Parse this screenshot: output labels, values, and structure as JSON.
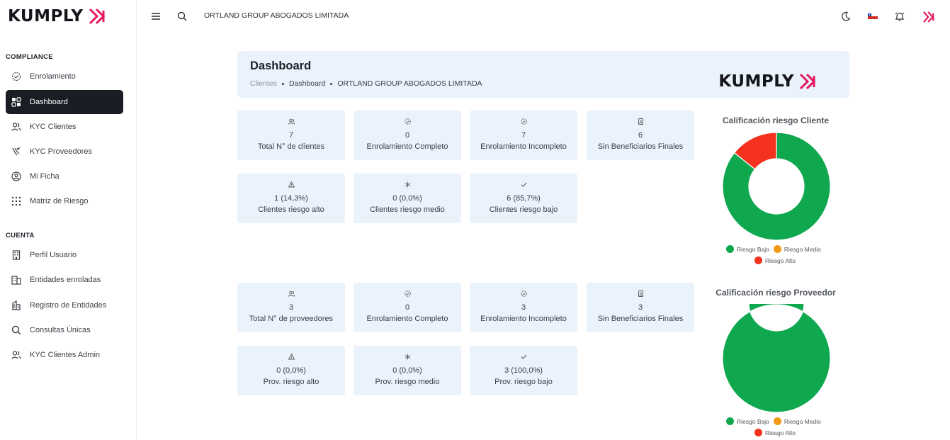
{
  "brand": {
    "logo_text": "KUMPLY",
    "accent": "#e5185f"
  },
  "sidebar": {
    "sections": [
      {
        "label": "COMPLIANCE"
      },
      {
        "label": "CUENTA"
      }
    ],
    "items": [
      {
        "label": "Enrolamiento",
        "icon": "check-circle-icon"
      },
      {
        "label": "Dashboard",
        "icon": "dashboard-grid-icon"
      },
      {
        "label": "KYC Clientes",
        "icon": "users-icon"
      },
      {
        "label": "KYC Proveedores",
        "icon": "handshake-icon"
      },
      {
        "label": "Mi Ficha",
        "icon": "user-circle-icon"
      },
      {
        "label": "Matriz de Riesgo",
        "icon": "dots-grid-icon"
      },
      {
        "label": "Perfil Usuario",
        "icon": "building-icon"
      },
      {
        "label": "Entidades enroladas",
        "icon": "buildings-icon"
      },
      {
        "label": "Registro de Entidades",
        "icon": "building-add-icon"
      },
      {
        "label": "Consultas Únicas",
        "icon": "search-icon"
      },
      {
        "label": "KYC Clientes Admin",
        "icon": "users-icon"
      }
    ]
  },
  "topbar": {
    "org_name": "ORTLAND GROUP ABOGADOS LIMITADA",
    "icons": [
      "menu-icon",
      "search-icon",
      "moon-icon",
      "chile-flag-icon",
      "bell-icon",
      "kumply-mark-icon"
    ]
  },
  "header": {
    "title": "Dashboard",
    "breadcrumb": [
      "Clientes",
      "Dashboard",
      "ORTLAND GROUP ABOGADOS LIMITADA"
    ]
  },
  "clientes": {
    "stats": [
      {
        "value": "7",
        "label": "Total N° de clientes",
        "icon": "users-icon"
      },
      {
        "value": "0",
        "label": "Enrolamiento Completo",
        "icon": "check-circle-icon"
      },
      {
        "value": "7",
        "label": "Enrolamiento Incompleto",
        "icon": "check-circle-icon"
      },
      {
        "value": "6",
        "label": "Sin Beneficiarios Finales",
        "icon": "document-icon"
      },
      {
        "value": "1 (14,3%)",
        "label": "Clientes riesgo alto",
        "icon": "warning-icon"
      },
      {
        "value": "0 (0,0%)",
        "label": "Clientes riesgo medio",
        "icon": "asterisk-icon"
      },
      {
        "value": "6 (85,7%)",
        "label": "Clientes riesgo bajo",
        "icon": "check-icon"
      }
    ]
  },
  "proveedores": {
    "stats": [
      {
        "value": "3",
        "label": "Total N° de proveedores",
        "icon": "users-icon"
      },
      {
        "value": "0",
        "label": "Enrolamiento Completo",
        "icon": "check-circle-icon"
      },
      {
        "value": "3",
        "label": "Enrolamiento Incompleto",
        "icon": "check-circle-icon"
      },
      {
        "value": "3",
        "label": "Sin Beneficiarios Finales",
        "icon": "document-icon"
      },
      {
        "value": "0 (0,0%)",
        "label": "Prov. riesgo alto",
        "icon": "warning-icon"
      },
      {
        "value": "0 (0,0%)",
        "label": "Prov. riesgo medio",
        "icon": "asterisk-icon"
      },
      {
        "value": "3 (100,0%)",
        "label": "Prov. riesgo bajo",
        "icon": "check-icon"
      }
    ]
  },
  "chart_data": [
    {
      "type": "pie",
      "title": "Calificación riesgo Cliente",
      "categories": [
        "Riesgo Bajo",
        "Riesgo Medio",
        "Riesgo Alto"
      ],
      "values": [
        6,
        0,
        1
      ],
      "colors": [
        "#0fa84f",
        "#f29a13",
        "#f4321e"
      ],
      "donut": true,
      "legend": "bottom"
    },
    {
      "type": "pie",
      "title": "Calificación riesgo Proveedor",
      "categories": [
        "Riesgo Bajo",
        "Riesgo Medio",
        "Riesgo Alto"
      ],
      "values": [
        3,
        0,
        0
      ],
      "colors": [
        "#0fa84f",
        "#f29a13",
        "#f4321e"
      ],
      "donut": true,
      "legend": "bottom"
    }
  ]
}
